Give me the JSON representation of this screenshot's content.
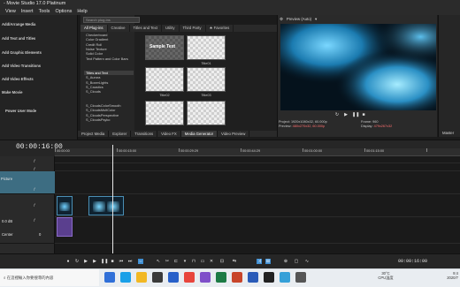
{
  "window": {
    "title": "- Movie Studio 17.0 Platinum"
  },
  "menu": {
    "items": [
      "View",
      "Insert",
      "Tools",
      "Options",
      "Help"
    ]
  },
  "left_pane": {
    "items": [
      "Add/Arrange Media",
      "Add Text and Titles",
      "Add Graphic Elements",
      "Add Video Transitions",
      "Add Video Effects",
      "Make Movie",
      "Power User Mode"
    ]
  },
  "plugins": {
    "search_placeholder": "Search plug-ins",
    "tabs": [
      "All Plug-ins",
      "Creative",
      "Titles and Text",
      "Utility",
      "Third Party",
      "Favorites"
    ],
    "tree": [
      "Checkerboard",
      "Color Gradient",
      "Credit Roll",
      "Noise Texture",
      "Solid Color",
      "Text Pattern and Color Bars",
      "Titles and Text",
      "S_Aurora",
      "S_BoxerLights",
      "S_Caustics",
      "S_Clouds",
      "S_CloudsColorSmooth",
      "S_CloudsMultColor",
      "S_CloudsPerspective",
      "S_CloudsPsyko"
    ],
    "thumbs": [
      {
        "label": "",
        "title_text": "Sample Text"
      },
      {
        "label": "Title01",
        "title_text": ""
      },
      {
        "label": "Title02",
        "title_text": ""
      },
      {
        "label": "Title03",
        "title_text": ""
      },
      {
        "label": "",
        "title_text": ""
      },
      {
        "label": "",
        "title_text": ""
      }
    ]
  },
  "pane_tabs": [
    "Project Media",
    "Explorer",
    "Transitions",
    "Video FX",
    "Media Generator",
    "Video Preview"
  ],
  "preview": {
    "label": "Preview (Auto)",
    "project_label": "Project:",
    "project_value": "1920x1080x32, 60.000p",
    "preview_label": "Preview:",
    "preview_value": "480x270x32, 60.000p",
    "frame_label": "Frame:",
    "frame_value": "960",
    "display_label": "Display:",
    "display_value": "479x267x32"
  },
  "master": {
    "label": "Master"
  },
  "timeline": {
    "timecode": "00:00:16:00",
    "ruler_labels": [
      "00:00:00",
      "00:00:15:00",
      "00:00:29:29",
      "00:00:44:29",
      "00:01:00:00",
      "00:01:15:00"
    ],
    "track1_name": "Picture",
    "track2_level": "0.0 dB",
    "track2_pan": "Center",
    "track2_pan_value": "0"
  },
  "transport": {
    "end_timecode": "00:00:16:00"
  },
  "taskbar": {
    "search_text": "在這裡輸入你要搜尋的內容",
    "weather_temp": "30°C",
    "weather_text": "CPU溫度",
    "time": "9:4",
    "date": "2020/7"
  },
  "colors": {
    "accent": "#3f8fd3",
    "video_clip_border": "#4a8fb5",
    "audio_clip": "#5a3f8e",
    "selected_track": "#3d6d82"
  }
}
